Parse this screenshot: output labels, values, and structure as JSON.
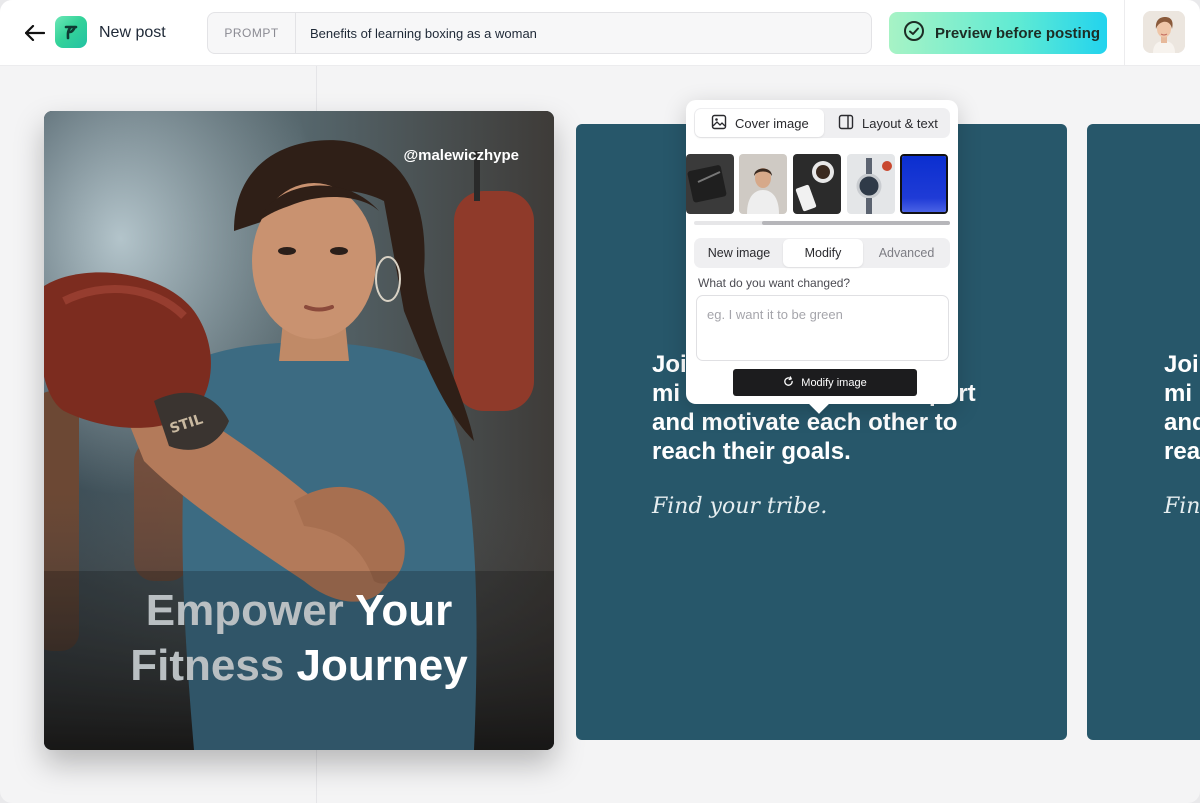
{
  "header": {
    "title": "New post",
    "prompt_tag": "PROMPT",
    "prompt_value": "Benefits of learning boxing as a woman",
    "preview_label": "Preview before posting"
  },
  "posts": [
    {
      "handle": "@malewiczhype",
      "headline_line1": [
        "Empower",
        "Your"
      ],
      "headline_line2": [
        "Fitness",
        "Journey"
      ]
    },
    {
      "body_lines": [
        "Join",
        "mi",
        "and motivate each other to",
        "reach their goals."
      ],
      "body_partial_right": "port",
      "tagline": "Find your tribe."
    },
    {
      "body_lines": [
        "Joi",
        "mi",
        "and",
        "rea"
      ],
      "tagline": "Fin"
    }
  ],
  "editor": {
    "tabs": [
      {
        "label": "Cover image",
        "active": true
      },
      {
        "label": "Layout & text",
        "active": false
      }
    ],
    "modes": [
      {
        "label": "New image",
        "active": false
      },
      {
        "label": "Modify",
        "active": true
      },
      {
        "label": "Advanced",
        "active": false
      }
    ],
    "question": "What do you want changed?",
    "placeholder": "eg. I want it to be green",
    "modify_label": "Modify image"
  },
  "colors": {
    "card_teal": "#27576a",
    "accent_gradient_start": "#a7f3c5",
    "accent_gradient_end": "#22d3ee",
    "selected_thumb_blue": "#1f3bd6"
  }
}
